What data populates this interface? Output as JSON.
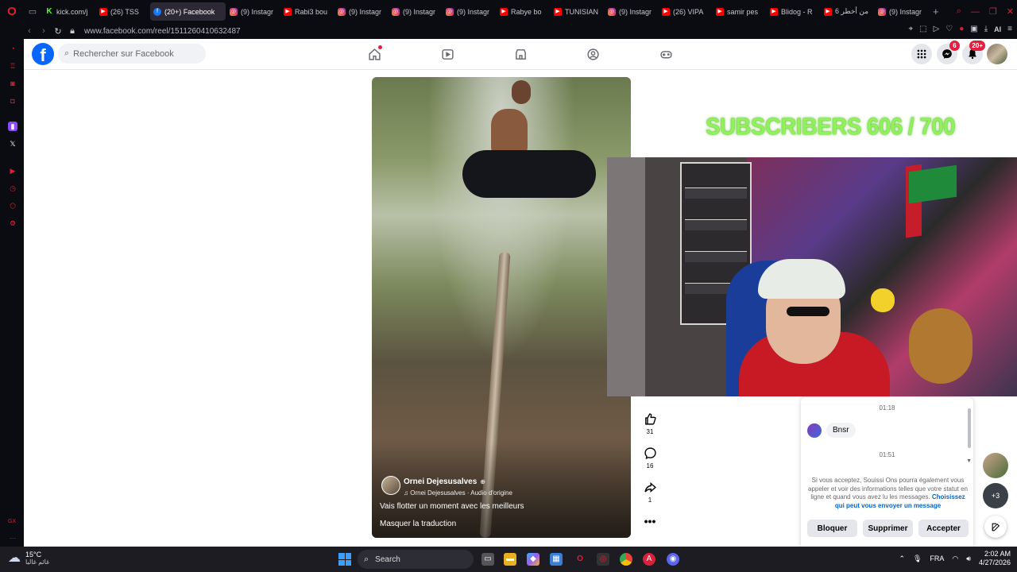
{
  "browser": {
    "tabs": [
      {
        "label": "kick.com/j",
        "favicon": "kick-icon",
        "active": false
      },
      {
        "label": "(26) TSS",
        "favicon": "youtube-icon",
        "active": false
      },
      {
        "label": "(20+) Facebook",
        "favicon": "facebook-icon",
        "active": true
      },
      {
        "label": "(9) Instagr",
        "favicon": "instagram-icon",
        "active": false
      },
      {
        "label": "Rabi3 bou",
        "favicon": "youtube-icon",
        "active": false
      },
      {
        "label": "(9) Instagr",
        "favicon": "instagram-icon",
        "active": false
      },
      {
        "label": "(9) Instagr",
        "favicon": "instagram-icon",
        "active": false
      },
      {
        "label": "(9) Instagr",
        "favicon": "instagram-icon",
        "active": false
      },
      {
        "label": "Rabye bo",
        "favicon": "youtube-icon",
        "active": false
      },
      {
        "label": "TUNISIAN",
        "favicon": "youtube-icon",
        "active": false
      },
      {
        "label": "(9) Instagr",
        "favicon": "instagram-icon",
        "active": false
      },
      {
        "label": "(26) VIPA",
        "favicon": "youtube-icon",
        "active": false
      },
      {
        "label": "samir pes",
        "favicon": "youtube-icon",
        "active": false
      },
      {
        "label": "Blidog - R",
        "favicon": "youtube-icon",
        "active": false
      },
      {
        "label": "6 من أخطر",
        "favicon": "youtube-icon",
        "active": false
      },
      {
        "label": "(9) Instagr",
        "favicon": "instagram-icon",
        "active": false
      }
    ],
    "url": "www.facebook.com/reel/1511260410632487",
    "ai_label": "AI",
    "sidebar_gx": "GX"
  },
  "facebook": {
    "logo": "f",
    "search_placeholder": "Rechercher sur Facebook",
    "nav": [
      "home-icon",
      "watch-icon",
      "marketplace-icon",
      "groups-icon",
      "gaming-icon"
    ],
    "messenger_badge": "6",
    "notifications_badge": "20+"
  },
  "reel": {
    "author": "Ornei Dejesusalves",
    "audio": "Ornei Dejesusalves · Audio d'origine",
    "caption": "Vais flotter un moment avec les meilleurs",
    "translate_toggle": "Masquer la traduction",
    "likes": "31",
    "comments": "16",
    "shares": "1"
  },
  "stream": {
    "subscribers_overlay": "SUBSCRIBERS 606 / 700"
  },
  "chat": {
    "time_1": "01:18",
    "message": "Bnsr",
    "time_2": "01:51",
    "notice_text": "Si vous acceptez, Souissi Ons pourra également vous appeler et voir des informations telles que votre statut en ligne et quand vous avez lu les messages.",
    "notice_link": "Choisissez qui peut vous envoyer un message",
    "buttons": {
      "block": "Bloquer",
      "delete": "Supprimer",
      "accept": "Accepter"
    }
  },
  "contacts": {
    "more_badge": "+3"
  },
  "taskbar": {
    "temperature": "15°C",
    "weather_condition": "غائم غالبا",
    "search_placeholder": "Search",
    "language": "FRA",
    "time": "2:02 AM",
    "date": "4/27/2026"
  }
}
